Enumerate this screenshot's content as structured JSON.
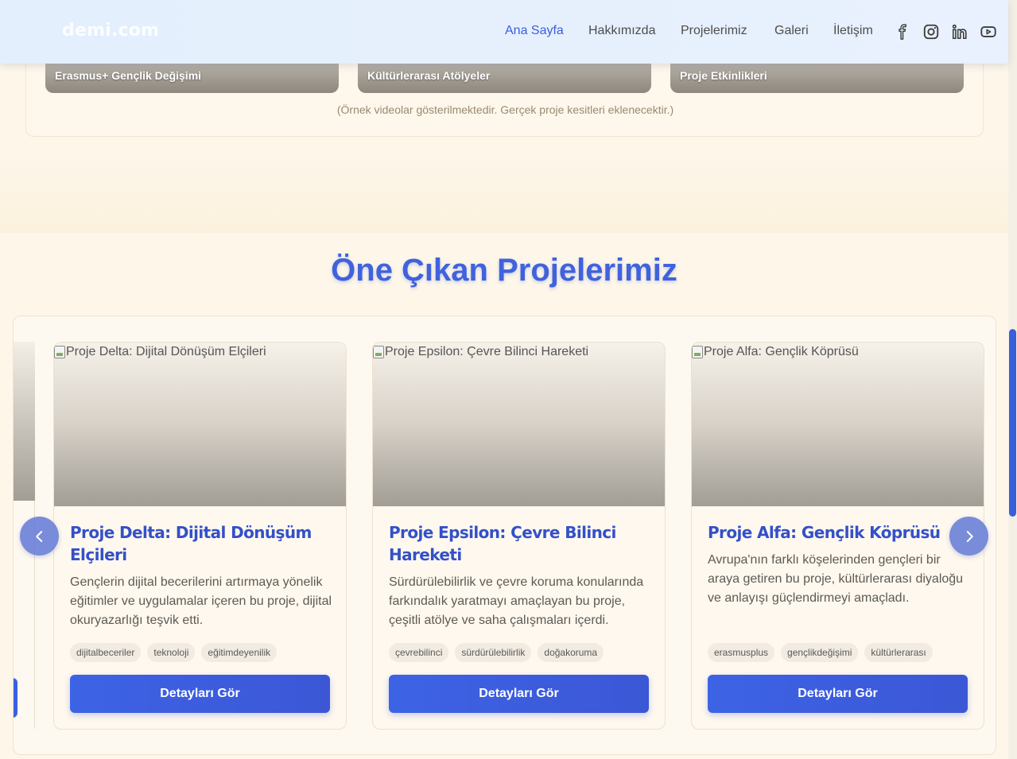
{
  "header": {
    "logo": "demi.com",
    "nav": [
      {
        "label": "Ana Sayfa",
        "active": true
      },
      {
        "label": "Hakkımızda",
        "active": false
      },
      {
        "label": "Projelerimiz",
        "active": false
      },
      {
        "label": "Galeri",
        "active": false
      },
      {
        "label": "İletişim",
        "active": false
      }
    ],
    "social_icons": [
      "facebook-icon",
      "instagram-icon",
      "linkedin-icon",
      "youtube-icon"
    ]
  },
  "videos": {
    "items": [
      {
        "label": "Erasmus+ Gençlik Değişimi"
      },
      {
        "label": "Kültürlerarası Atölyeler"
      },
      {
        "label": "Proje Etkinlikleri"
      }
    ],
    "note": "(Örnek videolar gösterilmektedir. Gerçek proje kesitleri eklenecektir.)"
  },
  "projects": {
    "title": "Öne Çıkan Projelerimiz",
    "button_label": "Detayları Gör",
    "cards": [
      {
        "image_alt": "Proje Delta: Dijital Dönüşüm Elçileri",
        "title": "Proje Delta: Dijital Dönüşüm Elçileri",
        "description": "Gençlerin dijital becerilerini artırmaya yönelik eğitimler ve uygulamalar içeren bu proje, dijital okuryazarlığı teşvik etti.",
        "tags": [
          "dijitalbeceriler",
          "teknoloji",
          "eğitimdeyenilik"
        ]
      },
      {
        "image_alt": "Proje Epsilon: Çevre Bilinci Hareketi",
        "title": "Proje Epsilon: Çevre Bilinci Hareketi",
        "description": "Sürdürülebilirlik ve çevre koruma konularında farkındalık yaratmayı amaçlayan bu proje, çeşitli atölye ve saha çalışmaları içerdi.",
        "tags": [
          "çevrebilinci",
          "sürdürülebilirlik",
          "doğakoruma"
        ]
      },
      {
        "image_alt": "Proje Alfa: Gençlik Köprüsü",
        "title": "Proje Alfa: Gençlik Köprüsü",
        "description": "Avrupa'nın farklı köşelerinden gençleri bir araya getiren bu proje, kültürlerarası diyaloğu ve anlayışı güçlendirmeyi amaçladı.",
        "tags": [
          "erasmusplus",
          "gençlikdeğişimi",
          "kültürlerarası"
        ]
      }
    ]
  },
  "colors": {
    "accent": "#3b5ed9",
    "title": "#4062dc",
    "background": "#fdf6e9"
  }
}
